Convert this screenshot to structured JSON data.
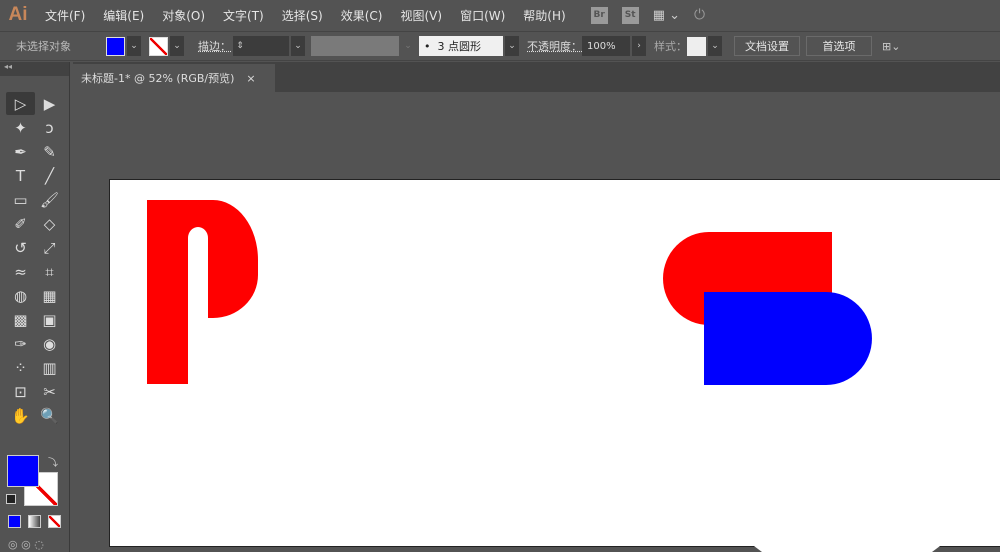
{
  "app": {
    "logo": "Ai"
  },
  "menu": [
    "文件(F)",
    "编辑(E)",
    "对象(O)",
    "文字(T)",
    "选择(S)",
    "效果(C)",
    "视图(V)",
    "窗口(W)",
    "帮助(H)"
  ],
  "menu_icons": {
    "bridge": "Br",
    "stock": "St"
  },
  "control": {
    "selection": "未选择对象",
    "stroke_label": "描边：",
    "brush": "3 点圆形",
    "opacity_label": "不透明度：",
    "opacity": "100%",
    "style_label": "样式：",
    "doc_setup": "文档设置",
    "preferences": "首选项"
  },
  "colors": {
    "fill": "#0000ff",
    "red": "#ff0000",
    "blue": "#0000ff"
  },
  "tab": {
    "title": "未标题-1* @ 52% (RGB/预览)",
    "close": "×"
  },
  "tools": [
    "selection-tool",
    "direct-selection-tool",
    "magic-wand-tool",
    "lasso-tool",
    "pen-tool",
    "curvature-tool",
    "type-tool",
    "line-tool",
    "rectangle-tool",
    "paintbrush-tool",
    "shaper-tool",
    "eraser-tool",
    "rotate-tool",
    "scale-tool",
    "warp-tool",
    "free-transform-tool",
    "shape-builder-tool",
    "perspective-grid-tool",
    "mesh-tool",
    "gradient-tool",
    "eyedropper-tool",
    "blend-tool",
    "symbol-sprayer-tool",
    "column-graph-tool",
    "artboard-tool",
    "slice-tool",
    "hand-tool",
    "zoom-tool"
  ]
}
